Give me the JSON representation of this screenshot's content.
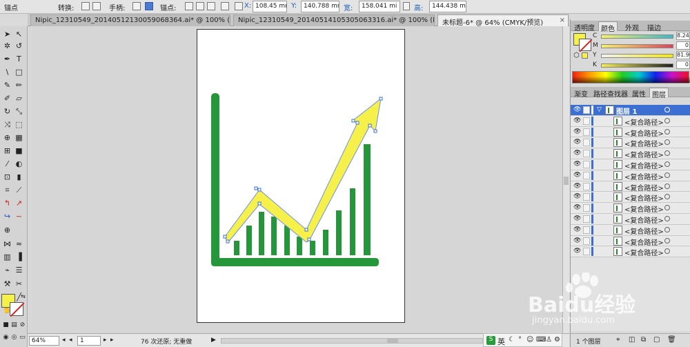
{
  "control_bar": {
    "anchor_label": "锚点",
    "convert_label": "转换:",
    "handle_label": "手柄:",
    "anchors_label": "锚点:",
    "x_label": "X:",
    "x_value": "108.45 mm",
    "y_label": "Y:",
    "y_value": "140.788 mm",
    "width_label": "宽:",
    "width_value": "158.041 mi",
    "height_label": "高:",
    "height_value": "144.438 mi"
  },
  "tabs": [
    {
      "label": "Nipic_12310549_20140512130059068364.ai* @ 100% (R..."
    },
    {
      "label": "Nipic_12310549_20140514105305063316.ai* @ 100% (R..."
    },
    {
      "label": "未标题-6* @ 64% (CMYK/预览)"
    }
  ],
  "status_bar": {
    "zoom": "64%",
    "page": "1",
    "undo_info": "76 次还原; 无重做"
  },
  "color_panel": {
    "tabs": [
      "透明度",
      "颜色",
      "外观",
      "描边"
    ],
    "active_tab": "颜色",
    "channels": [
      {
        "label": "C",
        "value": "8.24"
      },
      {
        "label": "M",
        "value": "0"
      },
      {
        "label": "Y",
        "value": "81.96"
      },
      {
        "label": "K",
        "value": "0"
      }
    ],
    "fill_color": "#f5f04a"
  },
  "layers_panel": {
    "tabs": [
      "渐变",
      "路径查找器",
      "属性",
      "图层"
    ],
    "active_tab": "图层",
    "layer_name": "图层 1",
    "items": [
      "<复合路径>",
      "<复合路径>",
      "<复合路径>",
      "<复合路径>",
      "<复合路径>",
      "<复合路径>",
      "<复合路径>",
      "<复合路径>",
      "<复合路径>",
      "<复合路径>",
      "<复合路径>",
      "<复合路径>",
      "<复合路径>"
    ],
    "footer_text": "1 个图层"
  },
  "ime": {
    "label": "英"
  },
  "watermark": {
    "line1": "Baidu经验",
    "line2": "jingyan.baidu.com"
  },
  "colors": {
    "chart_green": "#26963a",
    "arrow_yellow": "#f5f04a",
    "selection_blue": "#3b6fd4"
  }
}
